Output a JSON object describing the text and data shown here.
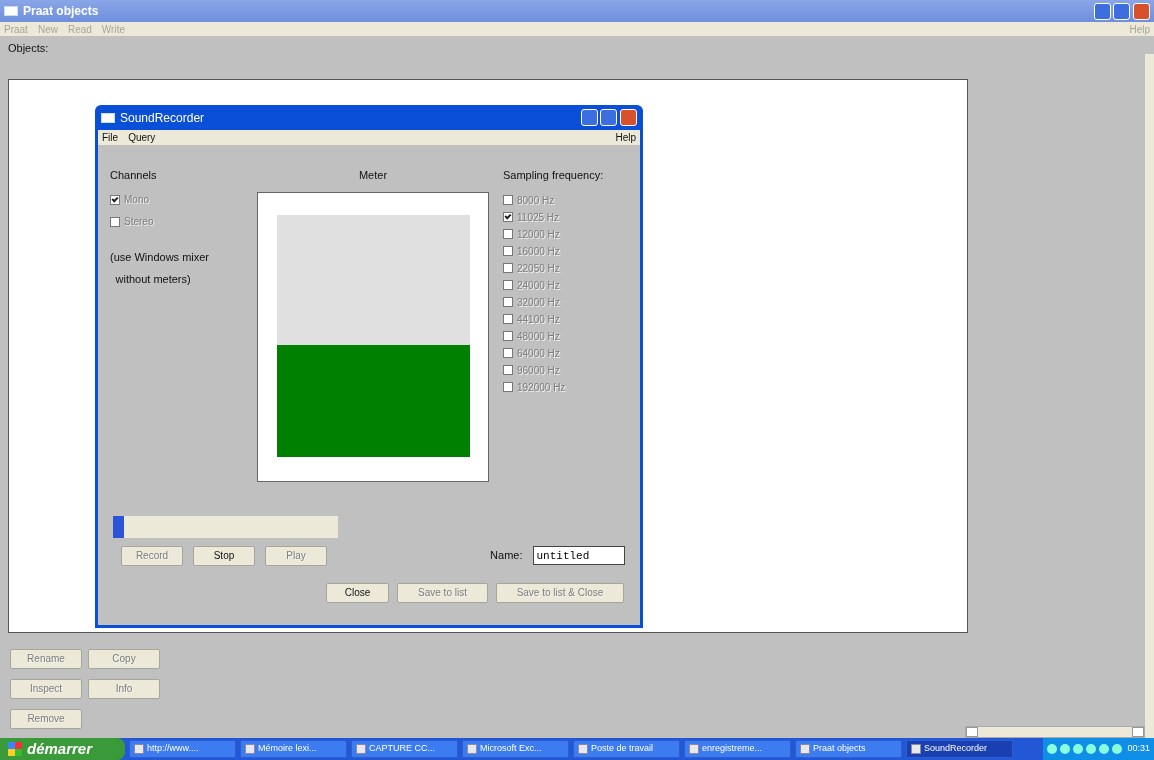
{
  "window": {
    "title": "Praat objects",
    "menu": [
      "Praat",
      "New",
      "Read",
      "Write"
    ],
    "menu_right": "Help"
  },
  "objects_label": "Objects:",
  "object_buttons": [
    {
      "label": "Rename",
      "disabled": true
    },
    {
      "label": "Copy",
      "disabled": true
    },
    {
      "label": "Inspect",
      "disabled": true
    },
    {
      "label": "Info",
      "disabled": true
    },
    {
      "label": "Remove",
      "disabled": true
    }
  ],
  "dialog": {
    "title": "SoundRecorder",
    "menu": [
      "File",
      "Query"
    ],
    "menu_right": "Help",
    "channels": {
      "heading": "Channels",
      "options": [
        {
          "label": "Mono",
          "selected": true,
          "disabled": true
        },
        {
          "label": "Stereo",
          "selected": false,
          "disabled": true
        }
      ],
      "note": [
        "(use Windows mixer",
        "without meters)"
      ]
    },
    "meter": {
      "heading": "Meter",
      "level": 0.46
    },
    "sampling": {
      "heading": "Sampling frequency:",
      "options": [
        {
          "label": "8000 Hz",
          "selected": false,
          "disabled": true
        },
        {
          "label": "11025 Hz",
          "selected": true,
          "disabled": true
        },
        {
          "label": "12000 Hz",
          "selected": false,
          "disabled": true
        },
        {
          "label": "16000 Hz",
          "selected": false,
          "disabled": true
        },
        {
          "label": "22050 Hz",
          "selected": false,
          "disabled": true
        },
        {
          "label": "24000 Hz",
          "selected": false,
          "disabled": true
        },
        {
          "label": "32000 Hz",
          "selected": false,
          "disabled": true
        },
        {
          "label": "44100 Hz",
          "selected": false,
          "disabled": true
        },
        {
          "label": "48000 Hz",
          "selected": false,
          "disabled": true
        },
        {
          "label": "64000 Hz",
          "selected": false,
          "disabled": true
        },
        {
          "label": "96000 Hz",
          "selected": false,
          "disabled": true
        },
        {
          "label": "192000 Hz",
          "selected": false,
          "disabled": true
        }
      ]
    },
    "progress": {
      "level": 0.05
    },
    "buttons": [
      {
        "label": "Record",
        "disabled": true
      },
      {
        "label": "Stop",
        "disabled": false
      },
      {
        "label": "Play",
        "disabled": true
      }
    ],
    "name_label": "Name:",
    "name_value": "untitled",
    "bottom_buttons": [
      {
        "label": "Close",
        "disabled": false
      },
      {
        "label": "Save to list",
        "disabled": true
      },
      {
        "label": "Save to list & Close",
        "disabled": true
      }
    ]
  },
  "taskbar": {
    "start": "démarrer",
    "tasks": [
      {
        "label": "http://www....",
        "selected": false
      },
      {
        "label": "Mémoire lexi...",
        "selected": false
      },
      {
        "label": "CAPTURE CC...",
        "selected": false
      },
      {
        "label": "Microsoft Exc...",
        "selected": false
      },
      {
        "label": "Poste de travail",
        "selected": false
      },
      {
        "label": "enregistreme...",
        "selected": false
      },
      {
        "label": "Praat objects",
        "selected": false
      },
      {
        "label": "SoundRecorder",
        "selected": true
      }
    ],
    "clock": "00:31"
  }
}
